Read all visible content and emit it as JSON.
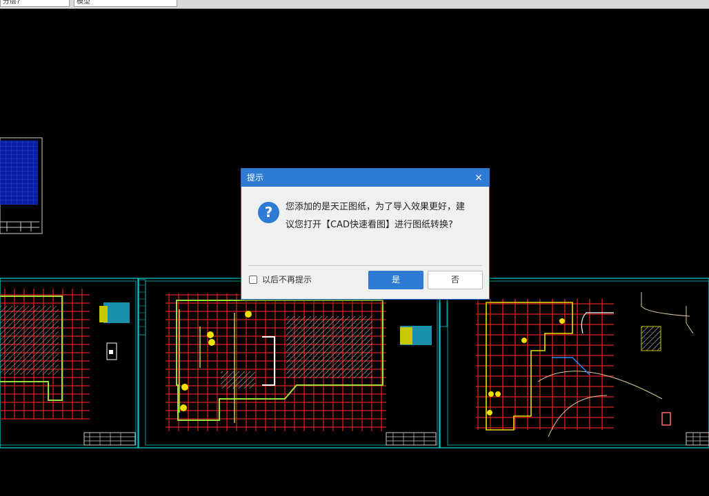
{
  "toolbar": {
    "field1_value": "分层?",
    "field2_value": "模型"
  },
  "dialog": {
    "title": "提示",
    "close_glyph": "×",
    "icon_glyph": "?",
    "message": "您添加的是天正图纸，为了导入效果更好，建议您打开【CAD快速看图】进行图纸转换?",
    "checkbox_label": "以后不再提示",
    "checkbox_checked": false,
    "yes_label": "是",
    "no_label": "否"
  },
  "colors": {
    "accent": "#2e7bd6",
    "canvas_bg": "#000000",
    "frame_cyan": "#00c8c8"
  }
}
